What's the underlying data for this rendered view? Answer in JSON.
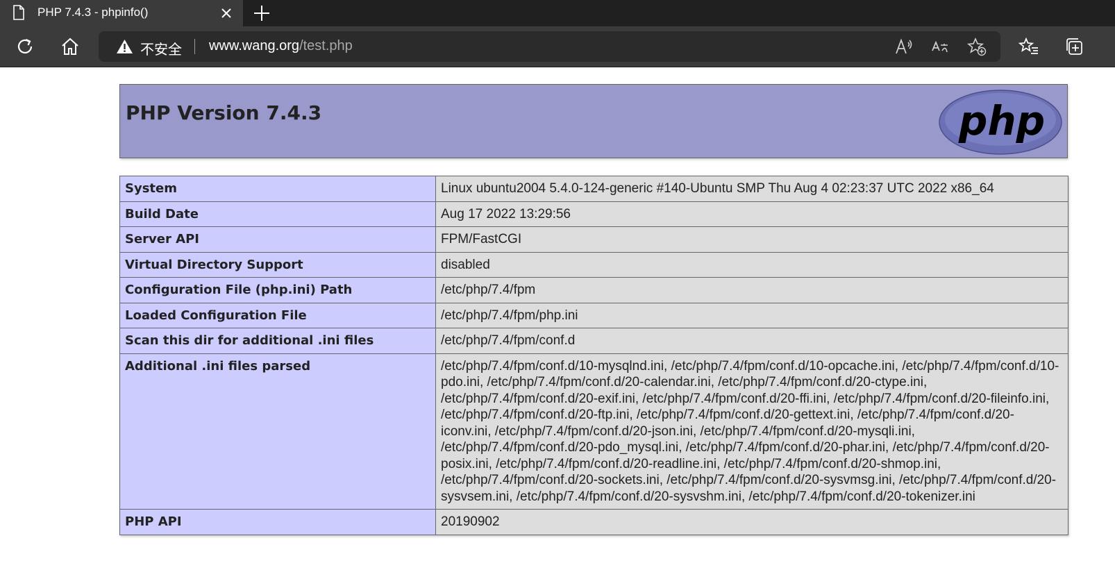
{
  "browser": {
    "tab": {
      "title": "PHP 7.4.3 - phpinfo()",
      "icon": "page-icon"
    },
    "address": {
      "security_label": "不安全",
      "host": "www.wang.org",
      "path": "/test.php"
    }
  },
  "page": {
    "heading": "PHP Version 7.4.3",
    "logo": "php",
    "rows": [
      {
        "label": "System",
        "value": "Linux ubuntu2004 5.4.0-124-generic #140-Ubuntu SMP Thu Aug 4 02:23:37 UTC 2022 x86_64"
      },
      {
        "label": "Build Date",
        "value": "Aug 17 2022 13:29:56"
      },
      {
        "label": "Server API",
        "value": "FPM/FastCGI"
      },
      {
        "label": "Virtual Directory Support",
        "value": "disabled"
      },
      {
        "label": "Configuration File (php.ini) Path",
        "value": "/etc/php/7.4/fpm"
      },
      {
        "label": "Loaded Configuration File",
        "value": "/etc/php/7.4/fpm/php.ini"
      },
      {
        "label": "Scan this dir for additional .ini files",
        "value": "/etc/php/7.4/fpm/conf.d"
      },
      {
        "label": "Additional .ini files parsed",
        "value": "/etc/php/7.4/fpm/conf.d/10-mysqlnd.ini, /etc/php/7.4/fpm/conf.d/10-opcache.ini, /etc/php/7.4/fpm/conf.d/10-pdo.ini, /etc/php/7.4/fpm/conf.d/20-calendar.ini, /etc/php/7.4/fpm/conf.d/20-ctype.ini, /etc/php/7.4/fpm/conf.d/20-exif.ini, /etc/php/7.4/fpm/conf.d/20-ffi.ini, /etc/php/7.4/fpm/conf.d/20-fileinfo.ini, /etc/php/7.4/fpm/conf.d/20-ftp.ini, /etc/php/7.4/fpm/conf.d/20-gettext.ini, /etc/php/7.4/fpm/conf.d/20-iconv.ini, /etc/php/7.4/fpm/conf.d/20-json.ini, /etc/php/7.4/fpm/conf.d/20-mysqli.ini, /etc/php/7.4/fpm/conf.d/20-pdo_mysql.ini, /etc/php/7.4/fpm/conf.d/20-phar.ini, /etc/php/7.4/fpm/conf.d/20-posix.ini, /etc/php/7.4/fpm/conf.d/20-readline.ini, /etc/php/7.4/fpm/conf.d/20-shmop.ini, /etc/php/7.4/fpm/conf.d/20-sockets.ini, /etc/php/7.4/fpm/conf.d/20-sysvmsg.ini, /etc/php/7.4/fpm/conf.d/20-sysvsem.ini, /etc/php/7.4/fpm/conf.d/20-sysvshm.ini, /etc/php/7.4/fpm/conf.d/20-tokenizer.ini"
      },
      {
        "label": "PHP API",
        "value": "20190902"
      }
    ]
  },
  "colors": {
    "header_bg": "#9999cc",
    "label_bg": "#ccccff",
    "value_bg": "#dddddd",
    "chrome_dark": "#202020",
    "chrome_toolbar": "#3b3b3b"
  }
}
